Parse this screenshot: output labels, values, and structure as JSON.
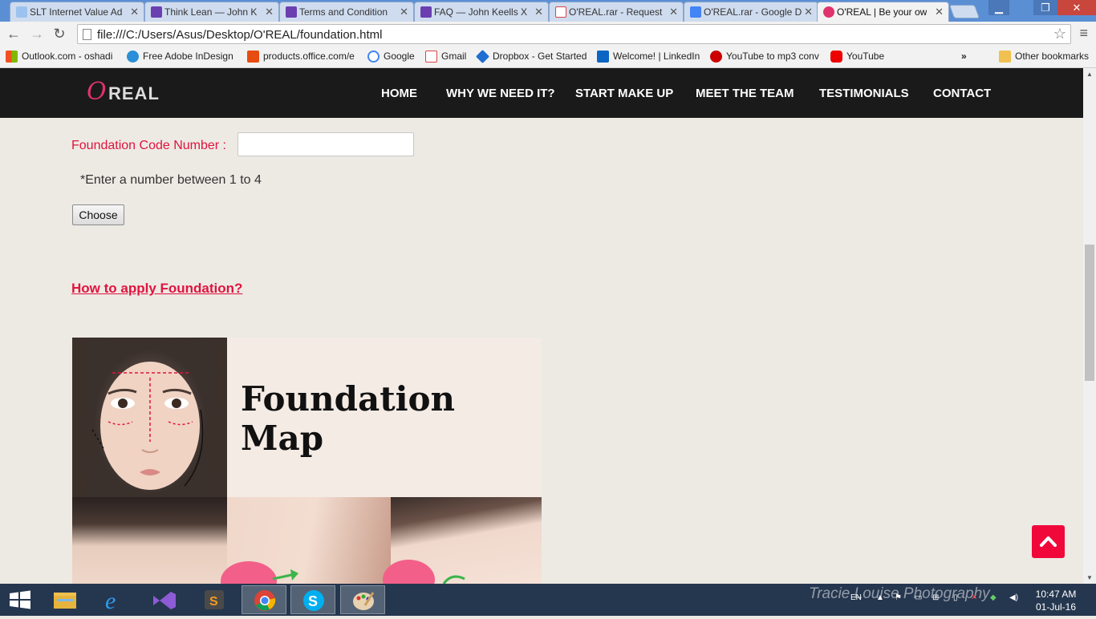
{
  "browser": {
    "tabs": [
      {
        "label": "SLT Internet Value Ad",
        "icon": "slt-icon",
        "color": "#3a6fc1"
      },
      {
        "label": "Think Lean — John K",
        "icon": "visual-studio-icon",
        "color": "#6b3fb0"
      },
      {
        "label": "Terms and Condition",
        "icon": "visual-studio-icon",
        "color": "#6b3fb0"
      },
      {
        "label": "FAQ — John Keells X",
        "icon": "visual-studio-icon",
        "color": "#6b3fb0"
      },
      {
        "label": "O'REAL.rar - Request",
        "icon": "gmail-icon",
        "color": "#d44"
      },
      {
        "label": "O'REAL.rar - Google D",
        "icon": "google-docs-icon",
        "color": "#4285f4"
      },
      {
        "label": "O'REAL | Be your own",
        "icon": "oreal-icon",
        "color": "#e0336b"
      }
    ],
    "address": "file:///C:/Users/Asus/Desktop/O'REAL/foundation.html",
    "bookmarks": [
      {
        "label": "Outlook.com - oshadi",
        "icon": "windows-icon",
        "color": "#f25022"
      },
      {
        "label": "Free Adobe InDesign",
        "icon": "sync-icon",
        "color": "#2a8fd8"
      },
      {
        "label": "products.office.com/e",
        "icon": "office-icon",
        "color": "#e74c10"
      },
      {
        "label": "Google",
        "icon": "google-icon",
        "color": "#4285f4"
      },
      {
        "label": "Gmail",
        "icon": "gmail-icon",
        "color": "#d44"
      },
      {
        "label": "Dropbox - Get Started",
        "icon": "dropbox-icon",
        "color": "#1f6fd1"
      },
      {
        "label": "Welcome! | LinkedIn",
        "icon": "linkedin-icon",
        "color": "#0a66c2"
      },
      {
        "label": "YouTube to mp3 conv",
        "icon": "youtube-mp3-icon",
        "color": "#c00"
      },
      {
        "label": "YouTube",
        "icon": "youtube-icon",
        "color": "#e00"
      }
    ],
    "bookmarks_more": "»",
    "other_bookmarks": "Other bookmarks"
  },
  "site": {
    "logo": {
      "o": "O",
      "rest": "REAL"
    },
    "nav": [
      "HOME",
      "WHY WE NEED IT?",
      "START MAKE UP",
      "MEET THE TEAM",
      "TESTIMONIALS",
      "CONTACT"
    ],
    "form": {
      "label": "Foundation Code Number :",
      "input_value": "",
      "hint": "*Enter a number between 1 to 4",
      "button": "Choose"
    },
    "howto_link": "How to apply Foundation?",
    "image": {
      "title": "Foundation Map"
    },
    "accent_color": "#e0143e"
  },
  "taskbar": {
    "apps": [
      "windows-start-icon",
      "file-explorer-icon",
      "internet-explorer-icon",
      "visual-studio-icon",
      "sublime-text-icon",
      "chrome-icon",
      "skype-icon",
      "paint-icon"
    ],
    "watermark": "Tracie Louise Photography",
    "language": "EN",
    "time": "10:47 AM",
    "date": "01-Jul-16"
  }
}
